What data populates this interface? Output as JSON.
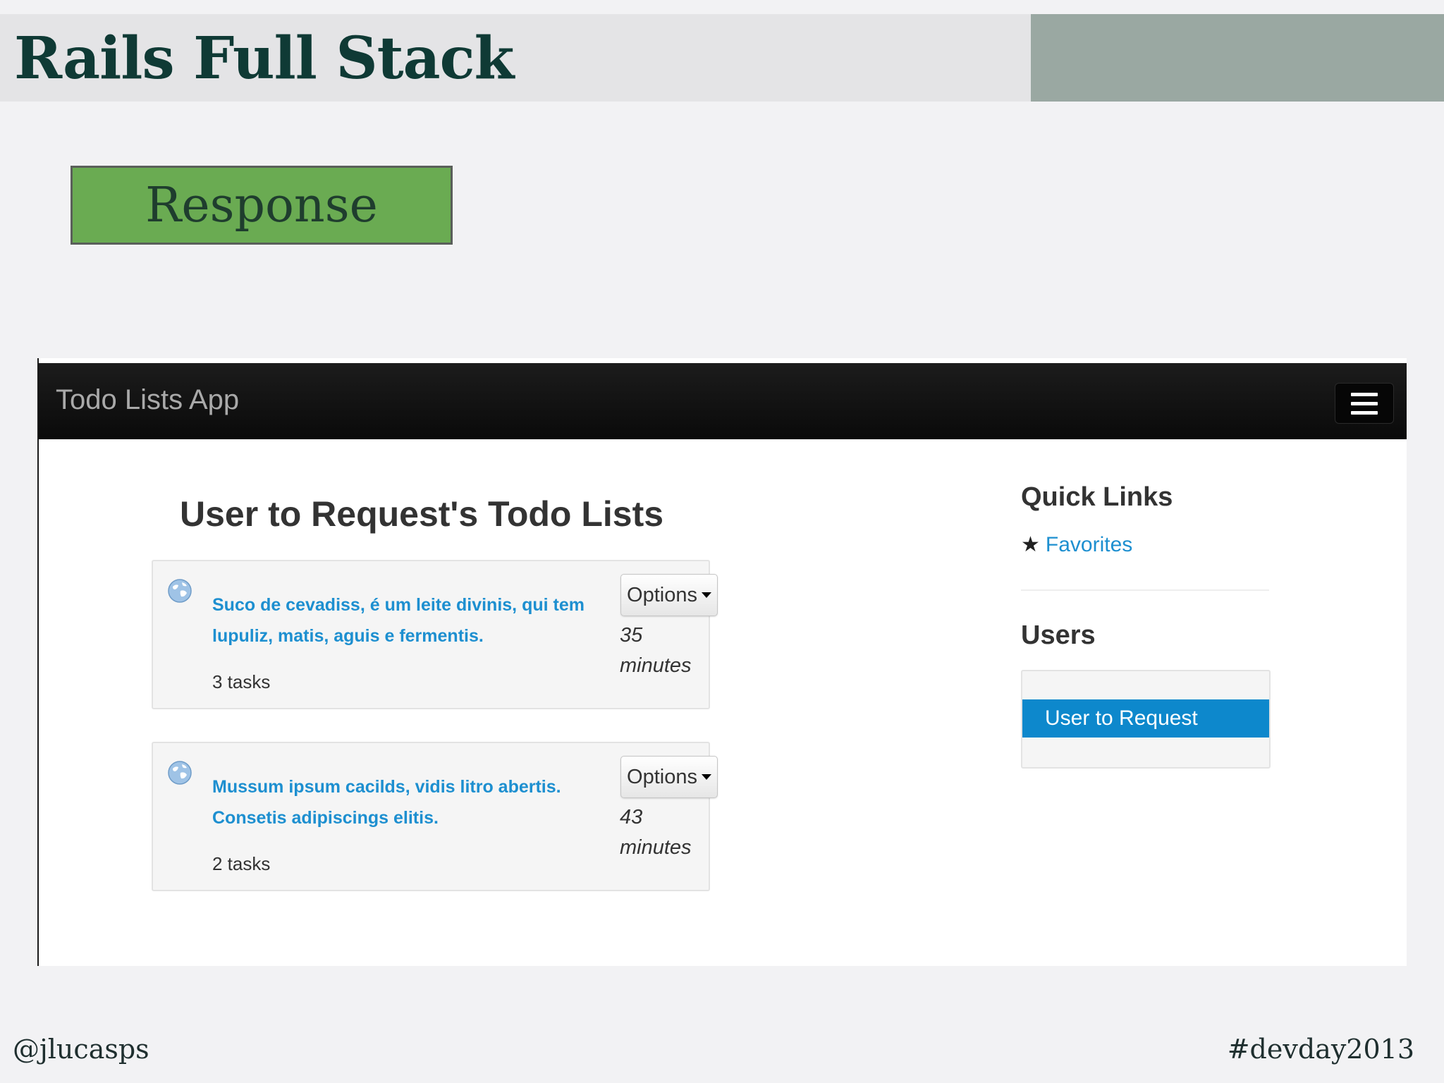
{
  "slide": {
    "title": "Rails Full Stack",
    "response_label": "Response",
    "footer_left": "@jlucasps",
    "footer_right": "#devday2013"
  },
  "app": {
    "brand": "Todo Lists App",
    "menu_icon": "hamburger-icon",
    "main_title": "User to Request's Todo Lists",
    "todo_lists": [
      {
        "title": "Suco de cevadiss, é um leite divinis, qui tem lupuliz, matis, aguis e fermentis.",
        "tasks": "3 tasks",
        "options_label": "Options",
        "time_value": "35",
        "time_unit": "minutes",
        "icon": "globe-icon"
      },
      {
        "title": "Mussum ipsum cacilds, vidis litro abertis. Consetis adipiscings elitis.",
        "tasks": "2 tasks",
        "options_label": "Options",
        "time_value": "43",
        "time_unit": "minutes",
        "icon": "globe-icon"
      }
    ],
    "sidebar": {
      "quick_links_heading": "Quick Links",
      "favorites_label": "Favorites",
      "favorites_icon": "star-icon",
      "users_heading": "Users",
      "users": [
        "User to Request"
      ]
    }
  },
  "colors": {
    "accent_green": "#6aab52",
    "header_gray": "#9aa8a2",
    "link_blue": "#1d8fd0",
    "selected_blue": "#0d88cc",
    "navbar_black": "#111111"
  }
}
